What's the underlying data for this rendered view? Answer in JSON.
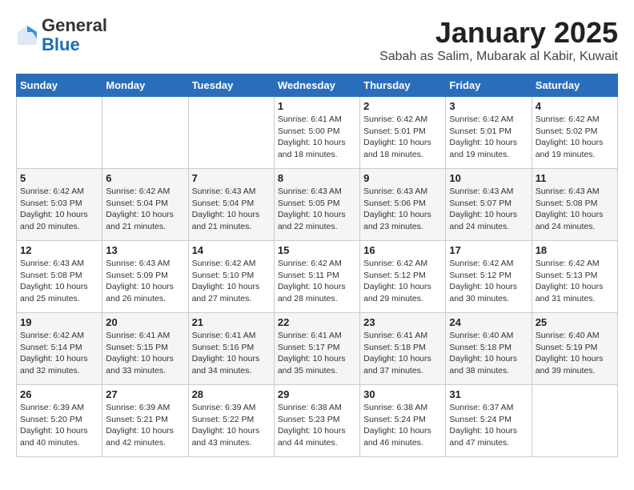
{
  "logo": {
    "general": "General",
    "blue": "Blue"
  },
  "header": {
    "month": "January 2025",
    "location": "Sabah as Salim, Mubarak al Kabir, Kuwait"
  },
  "days_of_week": [
    "Sunday",
    "Monday",
    "Tuesday",
    "Wednesday",
    "Thursday",
    "Friday",
    "Saturday"
  ],
  "weeks": [
    [
      {
        "day": "",
        "info": ""
      },
      {
        "day": "",
        "info": ""
      },
      {
        "day": "",
        "info": ""
      },
      {
        "day": "1",
        "info": "Sunrise: 6:41 AM\nSunset: 5:00 PM\nDaylight: 10 hours and 18 minutes."
      },
      {
        "day": "2",
        "info": "Sunrise: 6:42 AM\nSunset: 5:01 PM\nDaylight: 10 hours and 18 minutes."
      },
      {
        "day": "3",
        "info": "Sunrise: 6:42 AM\nSunset: 5:01 PM\nDaylight: 10 hours and 19 minutes."
      },
      {
        "day": "4",
        "info": "Sunrise: 6:42 AM\nSunset: 5:02 PM\nDaylight: 10 hours and 19 minutes."
      }
    ],
    [
      {
        "day": "5",
        "info": "Sunrise: 6:42 AM\nSunset: 5:03 PM\nDaylight: 10 hours and 20 minutes."
      },
      {
        "day": "6",
        "info": "Sunrise: 6:42 AM\nSunset: 5:04 PM\nDaylight: 10 hours and 21 minutes."
      },
      {
        "day": "7",
        "info": "Sunrise: 6:43 AM\nSunset: 5:04 PM\nDaylight: 10 hours and 21 minutes."
      },
      {
        "day": "8",
        "info": "Sunrise: 6:43 AM\nSunset: 5:05 PM\nDaylight: 10 hours and 22 minutes."
      },
      {
        "day": "9",
        "info": "Sunrise: 6:43 AM\nSunset: 5:06 PM\nDaylight: 10 hours and 23 minutes."
      },
      {
        "day": "10",
        "info": "Sunrise: 6:43 AM\nSunset: 5:07 PM\nDaylight: 10 hours and 24 minutes."
      },
      {
        "day": "11",
        "info": "Sunrise: 6:43 AM\nSunset: 5:08 PM\nDaylight: 10 hours and 24 minutes."
      }
    ],
    [
      {
        "day": "12",
        "info": "Sunrise: 6:43 AM\nSunset: 5:08 PM\nDaylight: 10 hours and 25 minutes."
      },
      {
        "day": "13",
        "info": "Sunrise: 6:43 AM\nSunset: 5:09 PM\nDaylight: 10 hours and 26 minutes."
      },
      {
        "day": "14",
        "info": "Sunrise: 6:42 AM\nSunset: 5:10 PM\nDaylight: 10 hours and 27 minutes."
      },
      {
        "day": "15",
        "info": "Sunrise: 6:42 AM\nSunset: 5:11 PM\nDaylight: 10 hours and 28 minutes."
      },
      {
        "day": "16",
        "info": "Sunrise: 6:42 AM\nSunset: 5:12 PM\nDaylight: 10 hours and 29 minutes."
      },
      {
        "day": "17",
        "info": "Sunrise: 6:42 AM\nSunset: 5:12 PM\nDaylight: 10 hours and 30 minutes."
      },
      {
        "day": "18",
        "info": "Sunrise: 6:42 AM\nSunset: 5:13 PM\nDaylight: 10 hours and 31 minutes."
      }
    ],
    [
      {
        "day": "19",
        "info": "Sunrise: 6:42 AM\nSunset: 5:14 PM\nDaylight: 10 hours and 32 minutes."
      },
      {
        "day": "20",
        "info": "Sunrise: 6:41 AM\nSunset: 5:15 PM\nDaylight: 10 hours and 33 minutes."
      },
      {
        "day": "21",
        "info": "Sunrise: 6:41 AM\nSunset: 5:16 PM\nDaylight: 10 hours and 34 minutes."
      },
      {
        "day": "22",
        "info": "Sunrise: 6:41 AM\nSunset: 5:17 PM\nDaylight: 10 hours and 35 minutes."
      },
      {
        "day": "23",
        "info": "Sunrise: 6:41 AM\nSunset: 5:18 PM\nDaylight: 10 hours and 37 minutes."
      },
      {
        "day": "24",
        "info": "Sunrise: 6:40 AM\nSunset: 5:18 PM\nDaylight: 10 hours and 38 minutes."
      },
      {
        "day": "25",
        "info": "Sunrise: 6:40 AM\nSunset: 5:19 PM\nDaylight: 10 hours and 39 minutes."
      }
    ],
    [
      {
        "day": "26",
        "info": "Sunrise: 6:39 AM\nSunset: 5:20 PM\nDaylight: 10 hours and 40 minutes."
      },
      {
        "day": "27",
        "info": "Sunrise: 6:39 AM\nSunset: 5:21 PM\nDaylight: 10 hours and 42 minutes."
      },
      {
        "day": "28",
        "info": "Sunrise: 6:39 AM\nSunset: 5:22 PM\nDaylight: 10 hours and 43 minutes."
      },
      {
        "day": "29",
        "info": "Sunrise: 6:38 AM\nSunset: 5:23 PM\nDaylight: 10 hours and 44 minutes."
      },
      {
        "day": "30",
        "info": "Sunrise: 6:38 AM\nSunset: 5:24 PM\nDaylight: 10 hours and 46 minutes."
      },
      {
        "day": "31",
        "info": "Sunrise: 6:37 AM\nSunset: 5:24 PM\nDaylight: 10 hours and 47 minutes."
      },
      {
        "day": "",
        "info": ""
      }
    ]
  ]
}
